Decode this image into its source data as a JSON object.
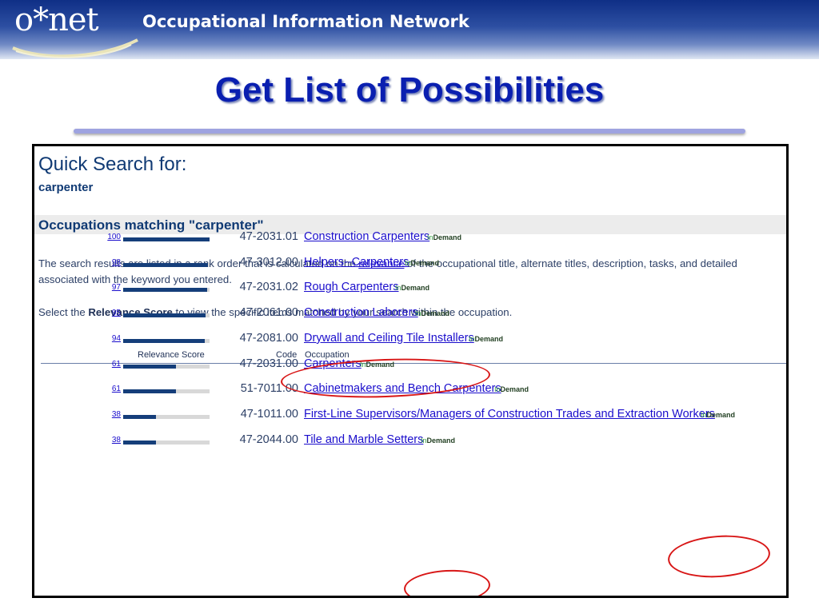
{
  "banner": {
    "logo_text": "o*net",
    "title": "Occupational Information Network"
  },
  "slide": {
    "title": "Get List of Possibilities"
  },
  "page": {
    "heading": "Quick Search for:",
    "search_term": "carpenter",
    "section_title": "Occupations matching \"carpenter\"",
    "desc_part1": "The search results are listed in a rank order that is calculated on the ",
    "desc_link": "relevance",
    "desc_part2": " of the occupational title, alternate titles, description, tasks, and detailed",
    "desc_line2": "associated with the keyword you entered.",
    "select_pre": "Select the ",
    "select_bold": "Relevance Score",
    "select_post": " to view the specific items matched by your search within the occupation."
  },
  "table": {
    "headers": {
      "score": "Relevance Score",
      "code": "Code",
      "occupation": "Occupation"
    },
    "badge_in": "In",
    "badge_demand": "Demand",
    "rows": [
      {
        "score": "100",
        "code": "47-2031.01",
        "occupation": "Construction Carpenters"
      },
      {
        "score": "98",
        "code": "47-3012.00",
        "occupation": "Helpers--Carpenters"
      },
      {
        "score": "97",
        "code": "47-2031.02",
        "occupation": "Rough Carpenters"
      },
      {
        "score": "95",
        "code": "47-2061.00",
        "occupation": "Construction Laborers"
      },
      {
        "score": "94",
        "code": "47-2081.00",
        "occupation": "Drywall and Ceiling Tile Installers"
      },
      {
        "score": "61",
        "code": "47-2031.00",
        "occupation": "Carpenters"
      },
      {
        "score": "61",
        "code": "51-7011.00",
        "occupation": "Cabinetmakers and Bench Carpenters"
      },
      {
        "score": "38",
        "code": "47-1011.00",
        "occupation": "First-Line Supervisors/Managers of Construction Trades and Extraction Workers"
      },
      {
        "score": "38",
        "code": "47-2044.00",
        "occupation": "Tile and Marble Setters"
      }
    ]
  },
  "colors": {
    "accent": "#0a1fb0",
    "banner": "#1a3a8f",
    "highlight": "#d81616",
    "bar": "#153e7a"
  }
}
